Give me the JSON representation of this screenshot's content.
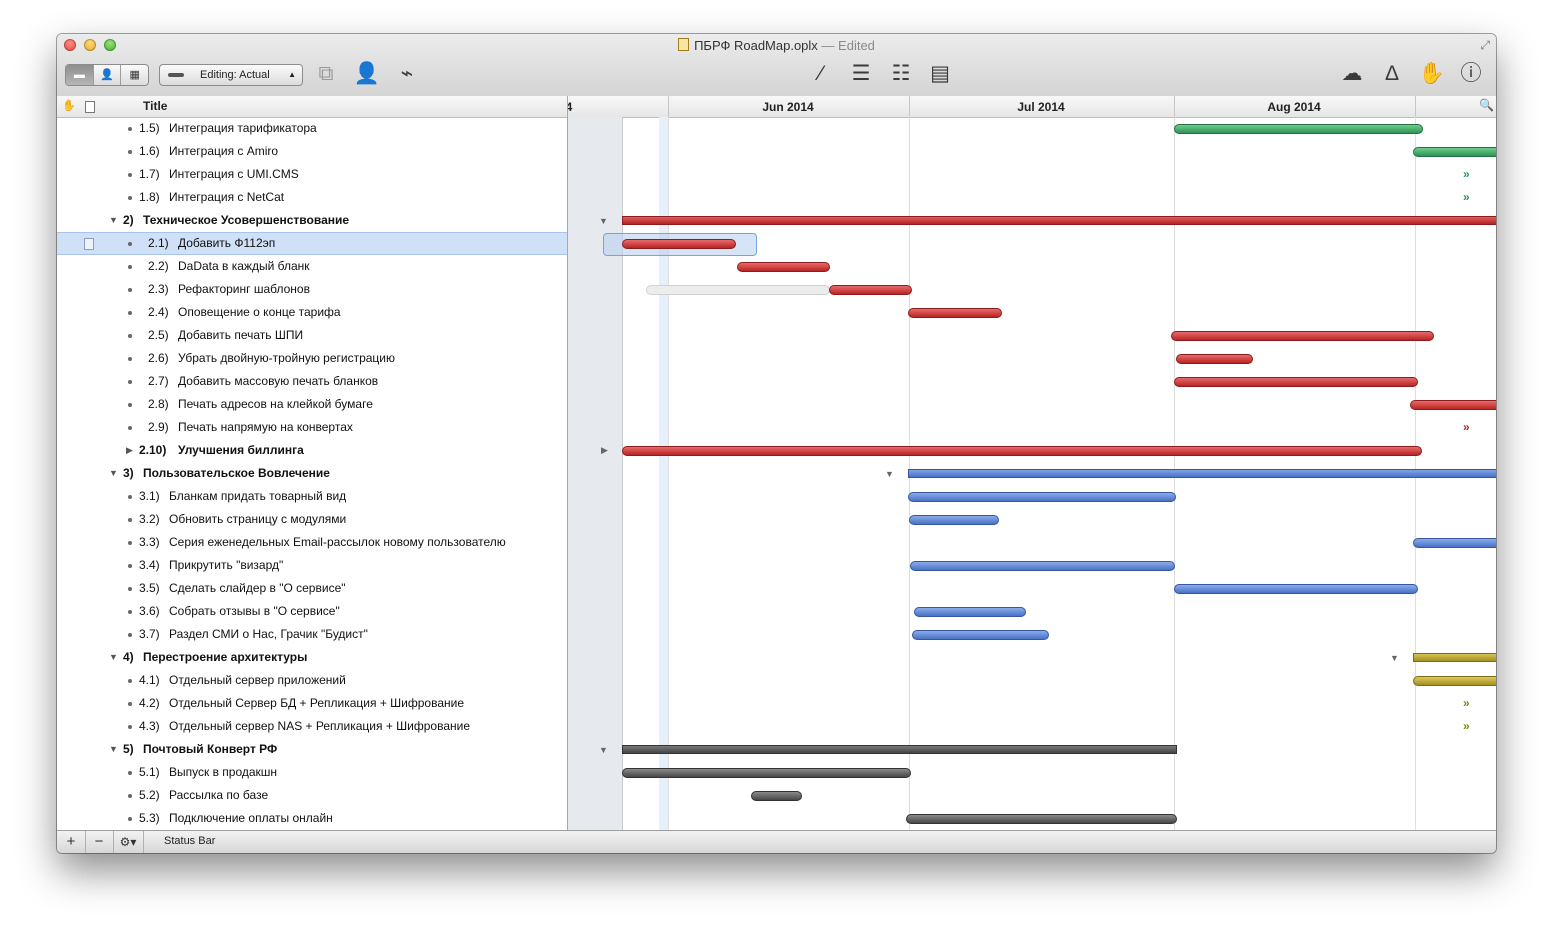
{
  "window": {
    "title": "ПБРФ RoadMap.oplx",
    "edited": "— Edited"
  },
  "toolbar": {
    "view_modes": [
      "▬",
      "👤",
      "▦"
    ],
    "editing_popup": "Editing: Actual",
    "icons": [
      "connect-tasks-icon",
      "resources-icon",
      "baseline-icon",
      "level-icon",
      "split-icon",
      "merge-icon",
      "report-icon",
      "publish-cloud-icon",
      "inspector-a-icon",
      "stop-hand-icon",
      "info-icon"
    ]
  },
  "outline": {
    "header_title": "Title",
    "rows": [
      {
        "num": "1.5)",
        "text": "Интеграция тарификатора"
      },
      {
        "num": "1.6)",
        "text": "Интеграция с Amiro"
      },
      {
        "num": "1.7)",
        "text": "Интеграция с UMI.CMS"
      },
      {
        "num": "1.8)",
        "text": "Интеграция с NetCat"
      },
      {
        "num": "2)",
        "text": "Техническое Усовершенствование"
      },
      {
        "num": "2.1)",
        "text": "Добавить Ф112эп"
      },
      {
        "num": "2.2)",
        "text": "DaData в каждый бланк"
      },
      {
        "num": "2.3)",
        "text": "Рефакторинг шаблонов"
      },
      {
        "num": "2.4)",
        "text": "Оповещение о конце тарифа"
      },
      {
        "num": "2.5)",
        "text": "Добавить печать ШПИ"
      },
      {
        "num": "2.6)",
        "text": "Убрать двойную-тройную регистрацию"
      },
      {
        "num": "2.7)",
        "text": "Добавить массовую печать бланков"
      },
      {
        "num": "2.8)",
        "text": "Печать адресов на клейкой бумаге"
      },
      {
        "num": "2.9)",
        "text": "Печать напрямую на конвертах"
      },
      {
        "num": "2.10)",
        "text": "Улучшения биллинга"
      },
      {
        "num": "3)",
        "text": "Пользовательское Вовлечение"
      },
      {
        "num": "3.1)",
        "text": "Бланкам придать товарный вид"
      },
      {
        "num": "3.2)",
        "text": "Обновить страницу с модулями"
      },
      {
        "num": "3.3)",
        "text": "Серия еженедельных Email-рассылок новому пользователю"
      },
      {
        "num": "3.4)",
        "text": "Прикрутить \"визард\""
      },
      {
        "num": "3.5)",
        "text": "Сделать слайдер в \"О сервисе\""
      },
      {
        "num": "3.6)",
        "text": "Собрать отзывы в \"О сервисе\""
      },
      {
        "num": "3.7)",
        "text": "Раздел СМИ о Нас, Грачик \"Будист\""
      },
      {
        "num": "4)",
        "text": "Перестроение архитектуры"
      },
      {
        "num": "4.1)",
        "text": "Отдельный сервер приложений"
      },
      {
        "num": "4.2)",
        "text": "Отдельный Сервер БД + Репликация + Шифрование"
      },
      {
        "num": "4.3)",
        "text": "Отдельный сервер NAS + Репликация + Шифрование"
      },
      {
        "num": "5)",
        "text": "Почтовый Конверт РФ"
      },
      {
        "num": "5.1)",
        "text": "Выпуск в продакшн"
      },
      {
        "num": "5.2)",
        "text": "Рассылка по базе"
      },
      {
        "num": "5.3)",
        "text": "Подключение оплаты онлайн"
      }
    ]
  },
  "gantt": {
    "months": [
      "4",
      "Jun 2014",
      "Jul 2014",
      "Aug 2014"
    ],
    "colors": {
      "red": "#c43a3a",
      "green": "#3fa366",
      "blue": "#5b82d0",
      "olive": "#bda62b",
      "dark": "#555555"
    }
  },
  "statusbar": {
    "add": "+",
    "remove": "−",
    "gear": "⚙▾",
    "label": "Status Bar"
  }
}
